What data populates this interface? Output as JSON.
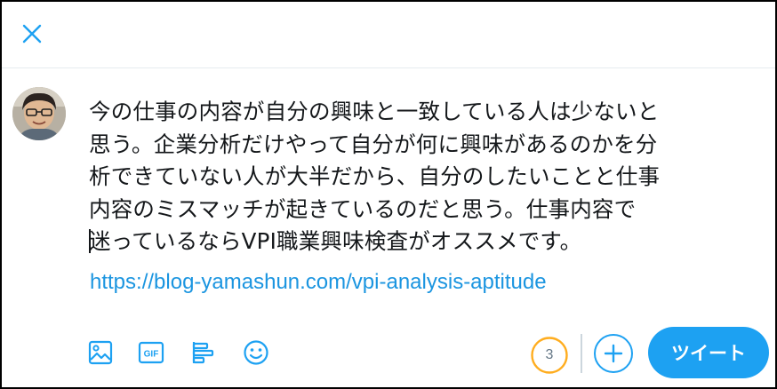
{
  "header": {
    "close_icon": "close-icon",
    "accent_color": "#1da1f2"
  },
  "composer": {
    "avatar_icon": "user-avatar-photo",
    "text_lines": [
      "今の仕事の内容が自分の興味と一致している人は少ないと",
      "思う。企業分析だけやって自分が何に興味があるのかを分",
      "析できていない人が大半だから、自分のしたいことと仕事",
      "内容のミスマッチが起きているのだと思う。仕事内容で",
      "迷っているならVPI職業興味検査がオススメです。"
    ],
    "link": "https://blog-yamashun.com/vpi-analysis-aptitude"
  },
  "toolbar": {
    "icons": [
      "image-icon",
      "gif-icon",
      "poll-icon",
      "emoji-icon"
    ],
    "counter_value": "3",
    "counter_color": "#ffad1f",
    "add_icon": "plus-icon",
    "tweet_label": "ツイート"
  }
}
